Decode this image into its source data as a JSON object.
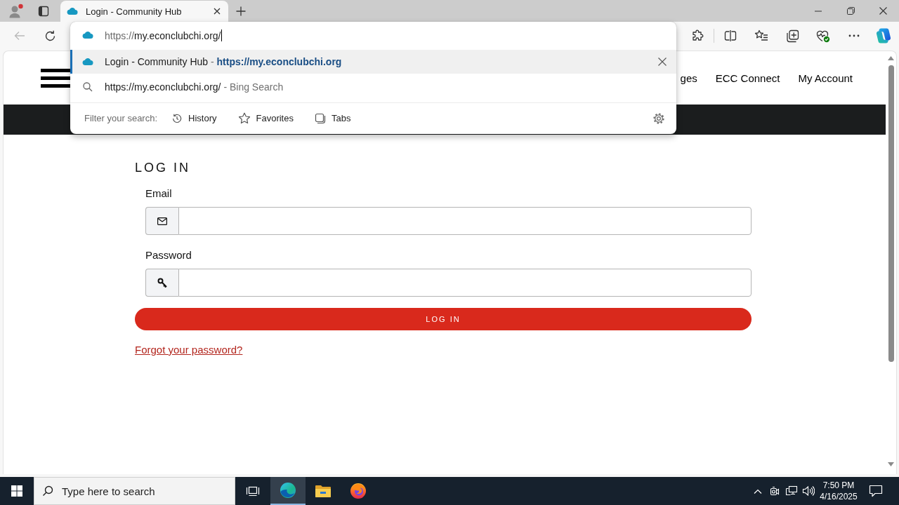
{
  "browser": {
    "profile": {
      "notification": true
    },
    "tabs": [
      {
        "title": "Login - Community Hub",
        "selected": true
      }
    ],
    "back_button": {
      "disabled": true
    },
    "address_bar": {
      "scheme": "https://",
      "rest": "my.econclubchi.org/"
    }
  },
  "omnibox_dropdown": {
    "suggestions": [
      {
        "kind": "page",
        "title": "Login - Community Hub",
        "separator": "-",
        "url": "https://my.econclubchi.org",
        "selected": true
      },
      {
        "kind": "search",
        "title": "https://my.econclubchi.org/",
        "separator": "-",
        "engine": "Bing Search",
        "selected": false
      }
    ],
    "filter_label": "Filter your search:",
    "filters": [
      {
        "kind": "history",
        "label": "History"
      },
      {
        "kind": "favorites",
        "label": "Favorites"
      },
      {
        "kind": "tabs",
        "label": "Tabs"
      }
    ]
  },
  "page": {
    "nav": [
      "ges",
      "ECC Connect",
      "My Account"
    ],
    "login_form": {
      "title": "LOG IN",
      "fields": [
        {
          "kind": "email",
          "label": "Email"
        },
        {
          "kind": "password",
          "label": "Password"
        }
      ],
      "submit_label": "LOG IN",
      "forgot_link": "Forgot your password?"
    }
  },
  "taskbar": {
    "search": {
      "placeholder": "Type here to search"
    },
    "apps": [
      {
        "kind": "edge",
        "active": true
      },
      {
        "kind": "explorer",
        "active": false
      },
      {
        "kind": "firefox",
        "active": false
      }
    ],
    "time": "7:50 PM",
    "date": "4/16/2025"
  }
}
